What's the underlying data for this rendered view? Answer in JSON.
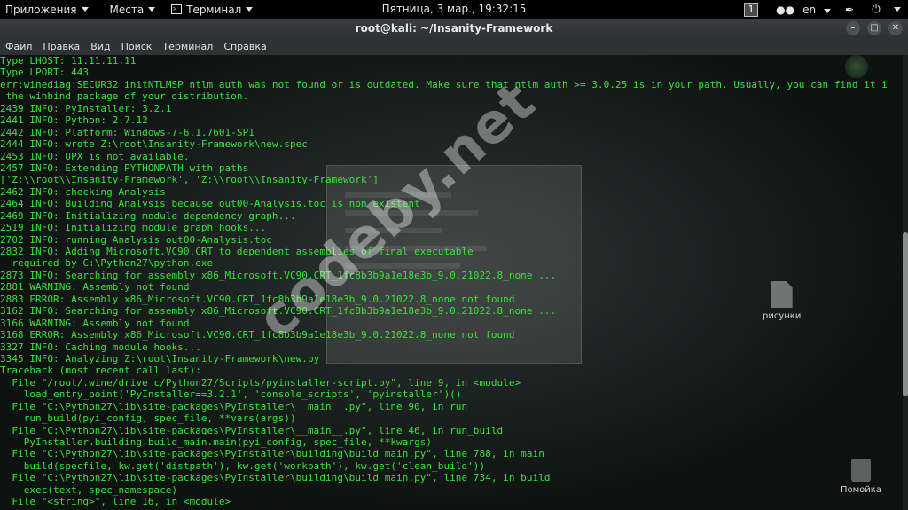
{
  "top_panel": {
    "applications": "Приложения",
    "places": "Места",
    "terminal": "Терминал",
    "clock": "Пятница,  3 мар., 19:32:15",
    "workspace": "1",
    "language": "en"
  },
  "window": {
    "title": "root@kali: ~/Insanity-Framework"
  },
  "menu": [
    "Файл",
    "Правка",
    "Вид",
    "Поиск",
    "Терминал",
    "Справка"
  ],
  "desktop": {
    "folder_label": "рисунки",
    "trash_label": "Помойка"
  },
  "terminal_lines": [
    "Type LHOST: 11.11.11.11",
    "Type LPORT: 443",
    "err:winediag:SECUR32_initNTLMSP ntlm_auth was not found or is outdated. Make sure that ntlm_auth >= 3.0.25 is in your path. Usually, you can find it i",
    " the winbind package of your distribution.",
    "2439 INFO: PyInstaller: 3.2.1",
    "2441 INFO: Python: 2.7.12",
    "2442 INFO: Platform: Windows-7-6.1.7601-SP1",
    "2444 INFO: wrote Z:\\root\\Insanity-Framework\\new.spec",
    "2453 INFO: UPX is not available.",
    "2457 INFO: Extending PYTHONPATH with paths",
    "['Z:\\\\root\\\\Insanity-Framework', 'Z:\\\\root\\\\Insanity-Framework']",
    "2462 INFO: checking Analysis",
    "2464 INFO: Building Analysis because out00-Analysis.toc is non existent",
    "2469 INFO: Initializing module dependency graph...",
    "2519 INFO: Initializing module graph hooks...",
    "2702 INFO: running Analysis out00-Analysis.toc",
    "2832 INFO: Adding Microsoft.VC90.CRT to dependent assemblies of final executable",
    "  required by C:\\Python27\\python.exe",
    "2873 INFO: Searching for assembly x86_Microsoft.VC90.CRT_1fc8b3b9a1e18e3b_9.0.21022.8_none ...",
    "2881 WARNING: Assembly not found",
    "2883 ERROR: Assembly x86_Microsoft.VC90.CRT_1fc8b3b9a1e18e3b_9.0.21022.8_none not found",
    "3162 INFO: Searching for assembly x86_Microsoft.VC90.CRT_1fc8b3b9a1e18e3b_9.0.21022.8_none ...",
    "3166 WARNING: Assembly not found",
    "3168 ERROR: Assembly x86_Microsoft.VC90.CRT_1fc8b3b9a1e18e3b_9.0.21022.8_none not found",
    "3327 INFO: Caching module hooks...",
    "3345 INFO: Analyzing Z:\\root\\Insanity-Framework\\new.py",
    "Traceback (most recent call last):",
    "  File \"/root/.wine/drive_c/Python27/Scripts/pyinstaller-script.py\", line 9, in <module>",
    "    load_entry_point('PyInstaller==3.2.1', 'console_scripts', 'pyinstaller')()",
    "  File \"C:\\Python27\\lib\\site-packages\\PyInstaller\\__main__.py\", line 90, in run",
    "    run_build(pyi_config, spec_file, **vars(args))",
    "  File \"C:\\Python27\\lib\\site-packages\\PyInstaller\\__main__.py\", line 46, in run_build",
    "    PyInstaller.building.build_main.main(pyi_config, spec_file, **kwargs)",
    "  File \"C:\\Python27\\lib\\site-packages\\PyInstaller\\building\\build_main.py\", line 788, in main",
    "    build(specfile, kw.get('distpath'), kw.get('workpath'), kw.get('clean_build'))",
    "  File \"C:\\Python27\\lib\\site-packages\\PyInstaller\\building\\build_main.py\", line 734, in build",
    "    exec(text, spec_namespace)",
    "  File \"<string>\", line 16, in <module>"
  ],
  "watermark": "codeby.net",
  "colors": {
    "terminal_text": "#39e23a",
    "panel_bg": "#000000"
  }
}
